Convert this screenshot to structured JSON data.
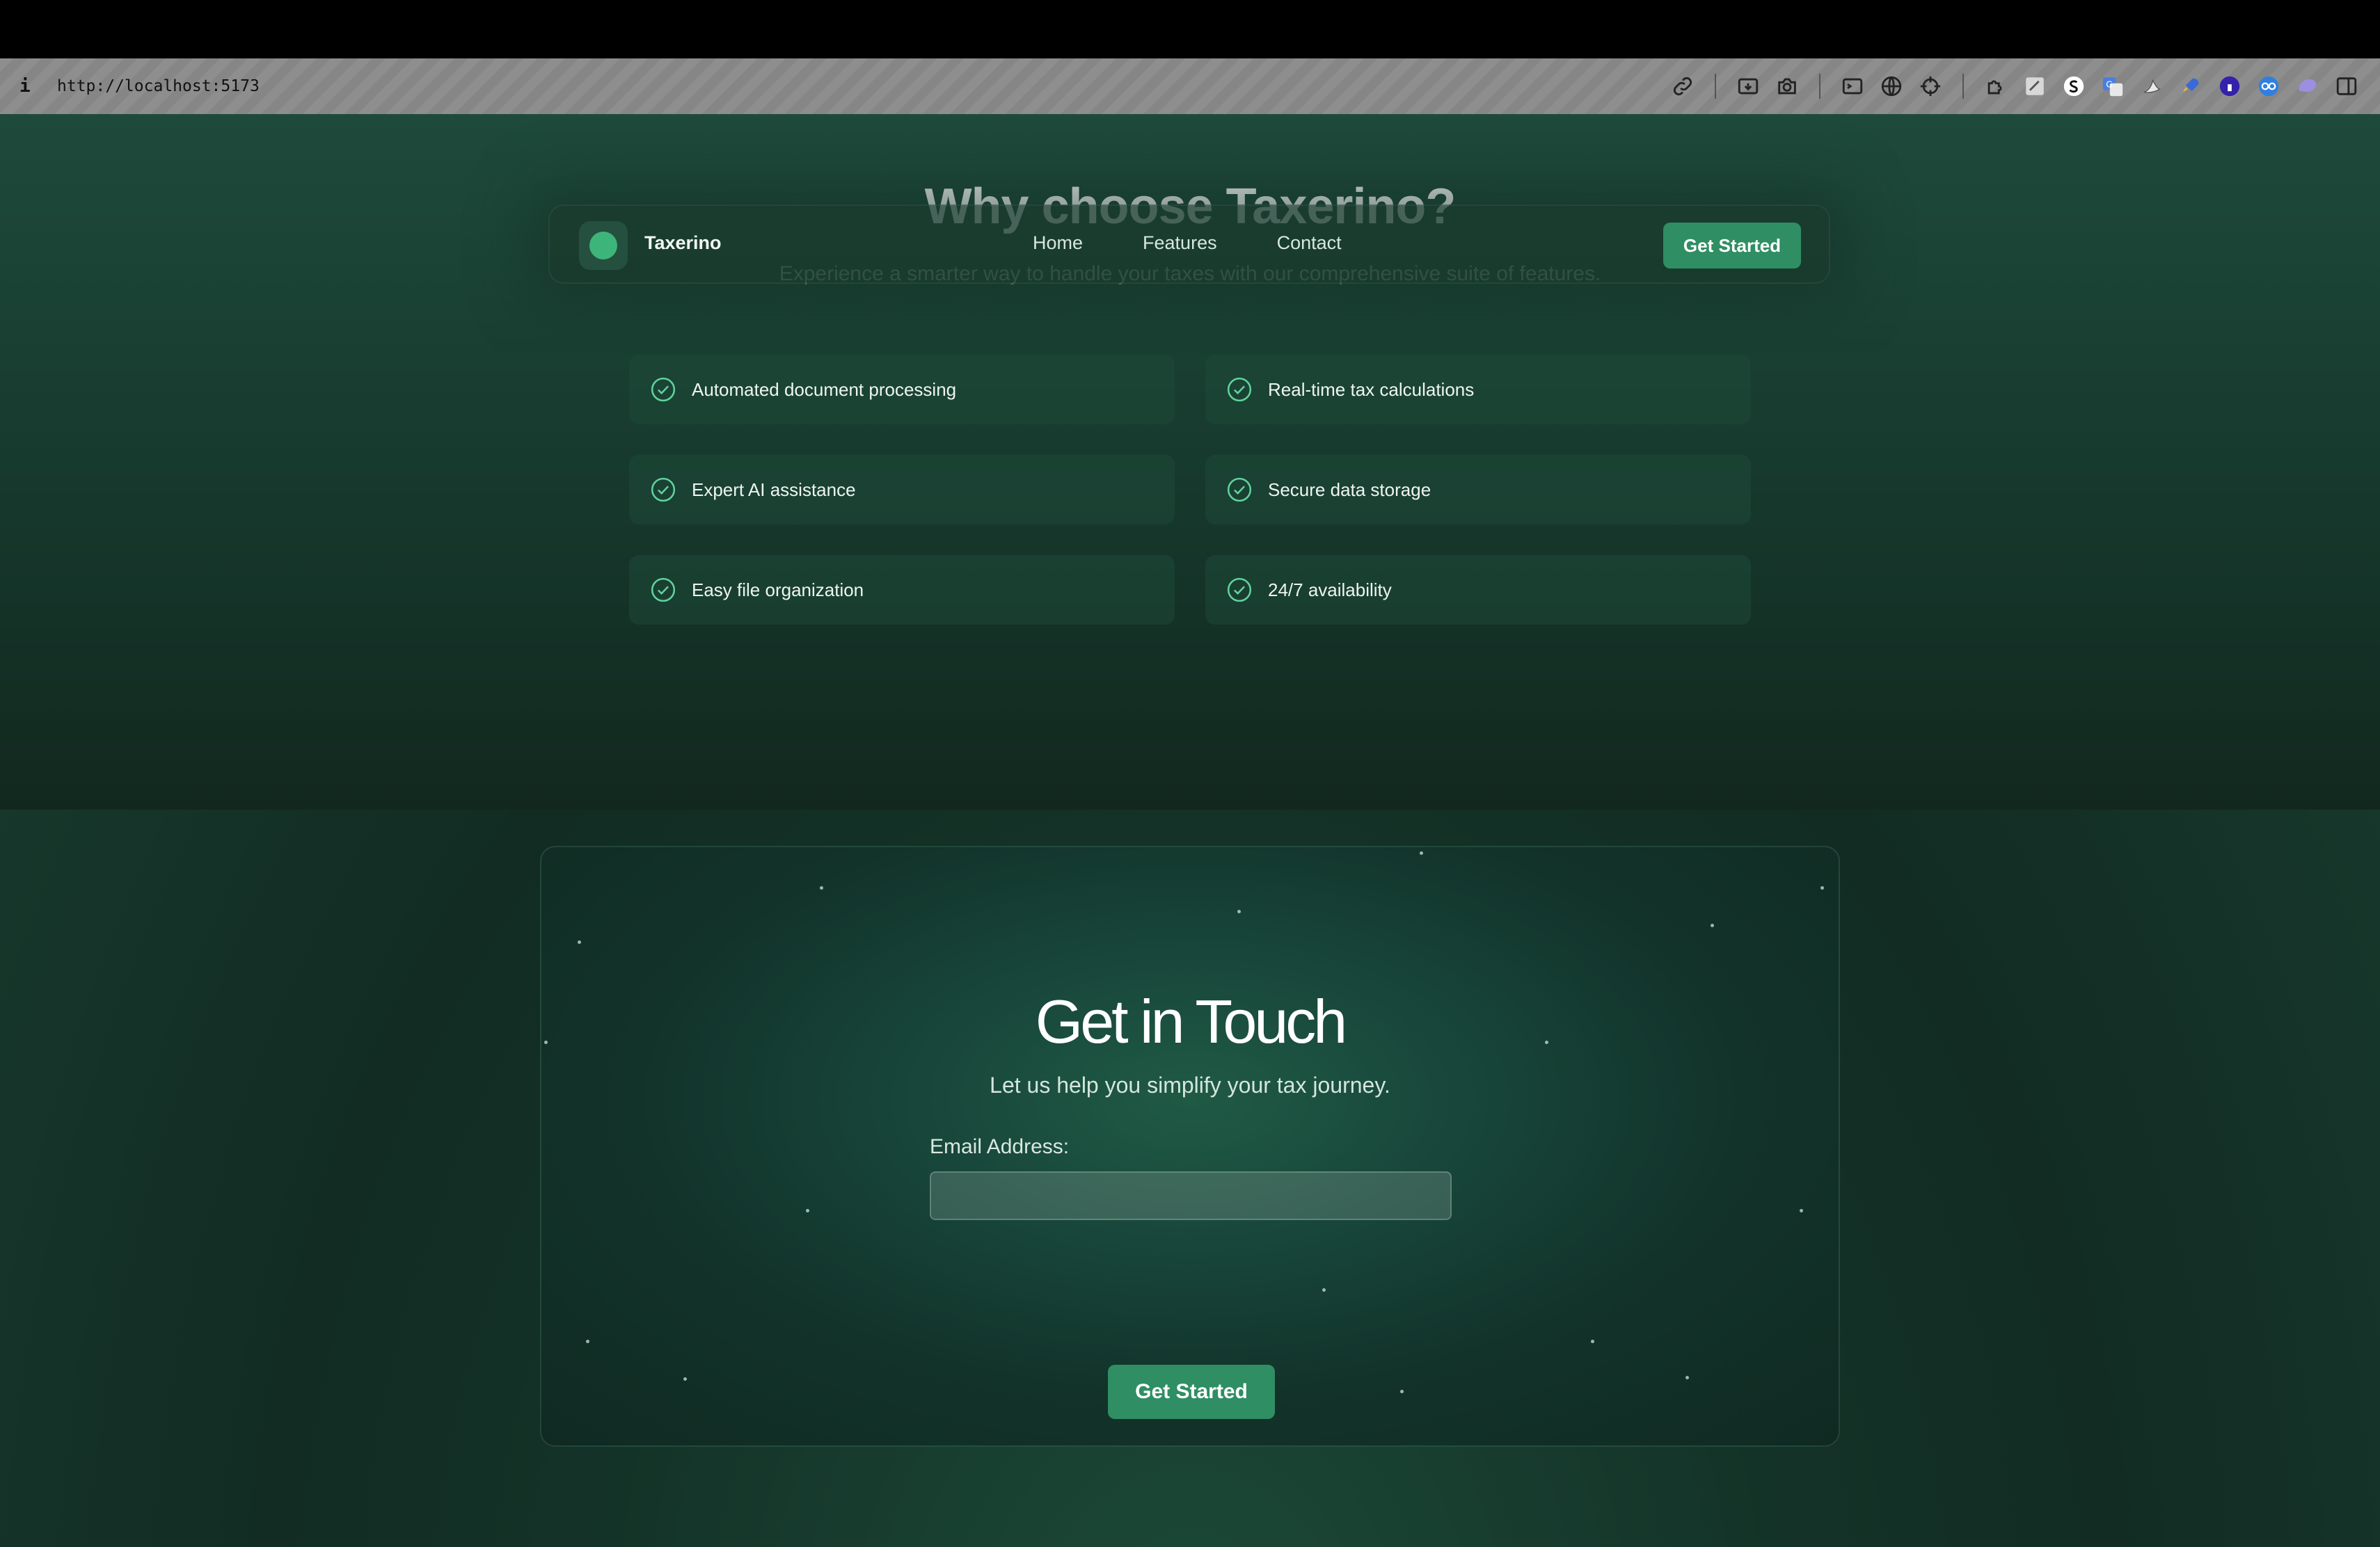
{
  "browser": {
    "info_glyph": "i",
    "url": "http://localhost:5173",
    "extension_icons": [
      "link-icon",
      "screen-capture-icon",
      "camera-icon",
      "terminal-icon",
      "globe-icon",
      "crosshair-icon",
      "puzzle-icon",
      "notes-icon",
      "s-extension-icon",
      "translate-icon",
      "bird-icon",
      "rocket-icon",
      "profile-icon",
      "goggles-icon",
      "blob-icon",
      "sidebar-icon"
    ]
  },
  "section": {
    "title": "Why choose Taxerino?",
    "subtitle": "Experience a smarter way to handle your taxes with our comprehensive suite of features."
  },
  "nav": {
    "brand": "Taxerino",
    "links": [
      "Home",
      "Features",
      "Contact"
    ],
    "cta": "Get Started"
  },
  "features": [
    "Automated document processing",
    "Real-time tax calculations",
    "Expert AI assistance",
    "Secure data storage",
    "Easy file organization",
    "24/7 availability"
  ],
  "contact": {
    "title": "Get in Touch",
    "subtitle": "Let us help you simplify your tax journey.",
    "email_label": "Email Address:",
    "email_value": "",
    "button": "Get Started"
  },
  "colors": {
    "accent": "#2f8e63",
    "logo_dot": "#3db57a",
    "check": "#5fd39b"
  }
}
